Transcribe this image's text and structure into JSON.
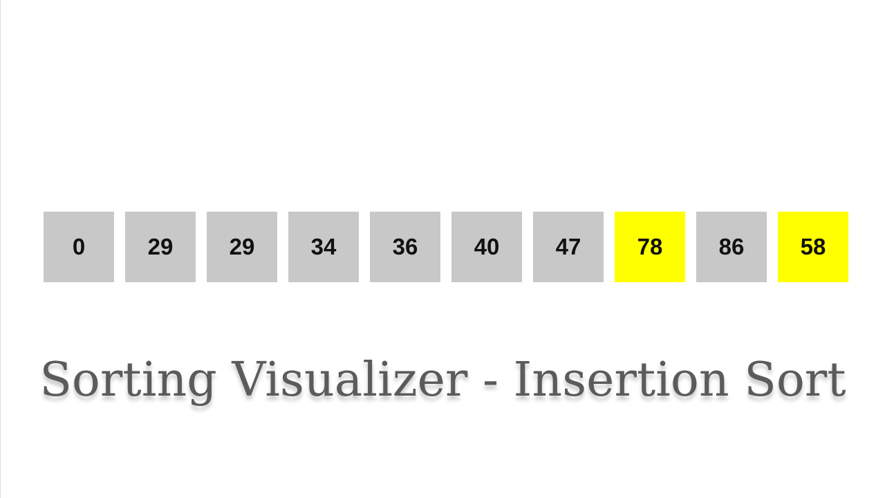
{
  "array": {
    "items": [
      {
        "value": "0",
        "state": "normal"
      },
      {
        "value": "29",
        "state": "normal"
      },
      {
        "value": "29",
        "state": "normal"
      },
      {
        "value": "34",
        "state": "normal"
      },
      {
        "value": "36",
        "state": "normal"
      },
      {
        "value": "40",
        "state": "normal"
      },
      {
        "value": "47",
        "state": "normal"
      },
      {
        "value": "78",
        "state": "active"
      },
      {
        "value": "86",
        "state": "normal"
      },
      {
        "value": "58",
        "state": "active"
      }
    ]
  },
  "colors": {
    "normal": "#c8c8c8",
    "active": "#ffff00",
    "title": "#5b5b5b"
  },
  "title": "Sorting Visualizer - Insertion Sort"
}
